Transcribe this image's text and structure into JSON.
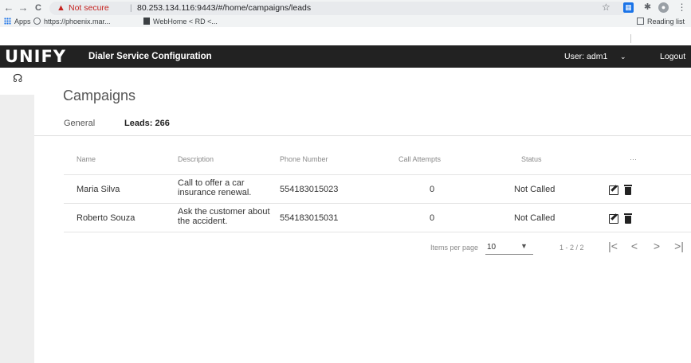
{
  "browser": {
    "nav": {
      "back": "←",
      "forward": "→",
      "reload": "C"
    },
    "security_label": "Not secure",
    "url": "80.253.134.116:9443/#/home/campaigns/leads",
    "bookmarks": [
      {
        "label": "Apps",
        "icon": "apps-icon"
      },
      {
        "label": "https://phoenix.mar...",
        "icon": "globe-icon"
      },
      {
        "label": "WebHome < RD <...",
        "icon": "bookmark-page-icon"
      }
    ],
    "reading_list": "Reading list"
  },
  "header": {
    "logo": "UNIFY",
    "title": "Dialer Service Configuration",
    "user_label": "User:",
    "user_name": "adm1",
    "logout": "Logout",
    "accent_color": "#1fb3aa"
  },
  "page": {
    "title": "Campaigns",
    "tabs": [
      {
        "label": "General",
        "active": false
      },
      {
        "label": "Leads: 266",
        "active": true
      }
    ]
  },
  "table": {
    "columns": [
      "Name",
      "Description",
      "Phone Number",
      "Call Attempts",
      "Status",
      "···"
    ],
    "rows": [
      {
        "name": "Maria Silva",
        "description": "Call to offer a car insurance renewal.",
        "phone": "554183015023",
        "attempts": "0",
        "status": "Not Called"
      },
      {
        "name": "Roberto Souza",
        "description": "Ask the customer about the accident.",
        "phone": "554183015031",
        "attempts": "0",
        "status": "Not Called"
      }
    ]
  },
  "paginator": {
    "items_per_page_label": "Items per page",
    "items_per_page": "10",
    "range": "1 - 2 / 2"
  }
}
